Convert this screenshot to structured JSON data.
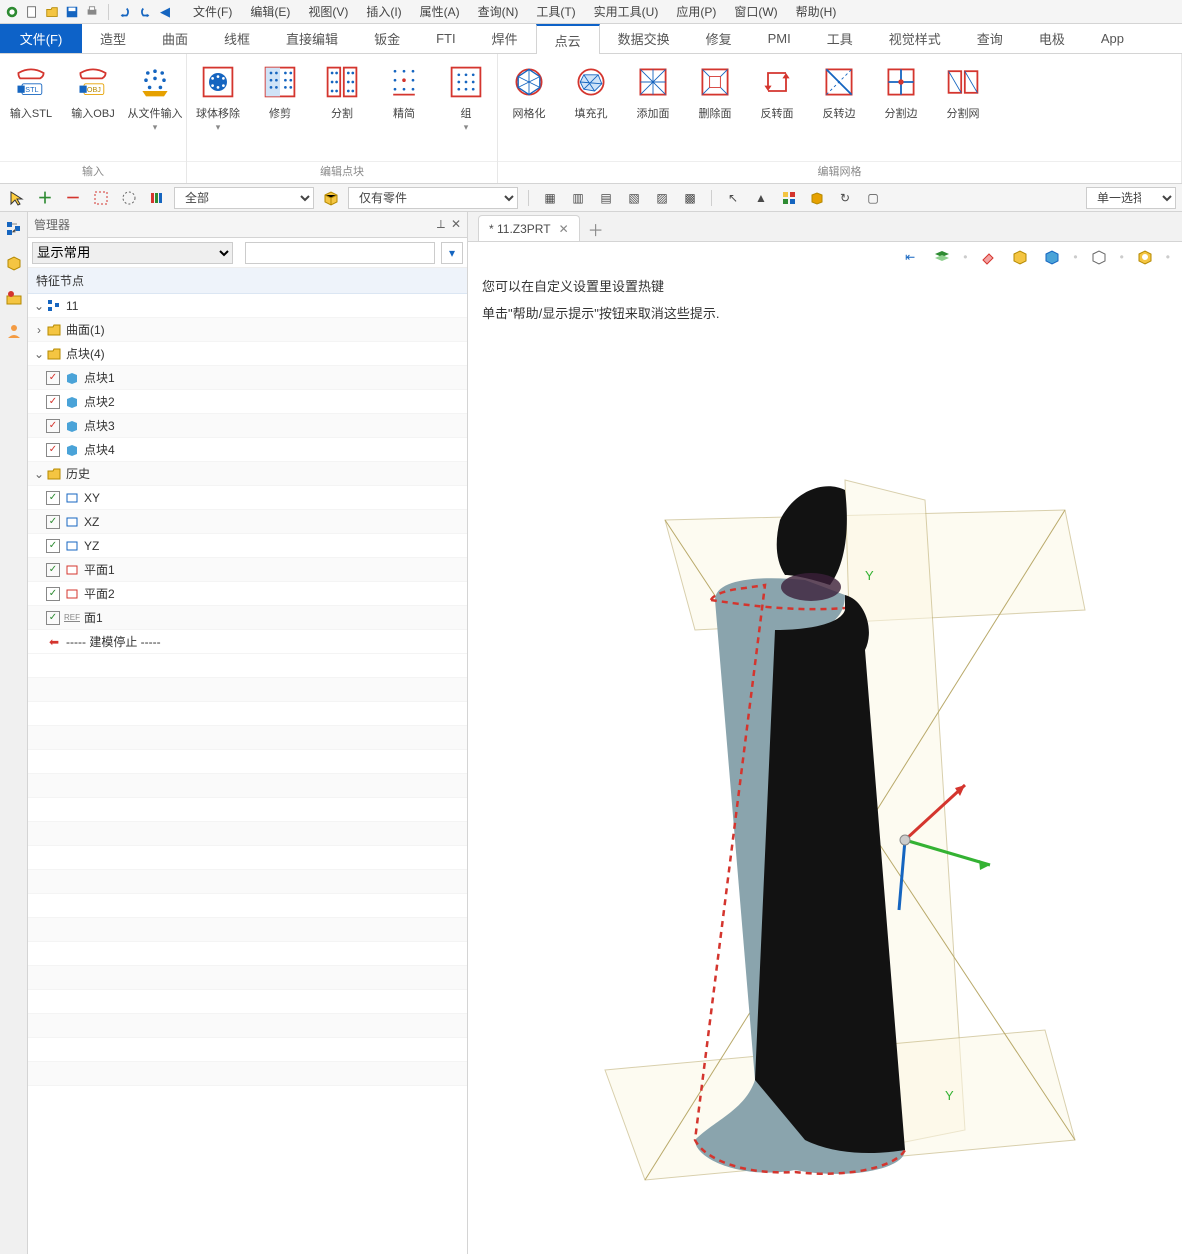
{
  "menus": {
    "items": [
      "文件(F)",
      "编辑(E)",
      "视图(V)",
      "插入(I)",
      "属性(A)",
      "查询(N)",
      "工具(T)",
      "实用工具(U)",
      "应用(P)",
      "窗口(W)",
      "帮助(H)"
    ]
  },
  "file_tab": "文件(F)",
  "ribbon_tabs": [
    "造型",
    "曲面",
    "线框",
    "直接编辑",
    "钣金",
    "FTI",
    "焊件",
    "点云",
    "数据交换",
    "修复",
    "PMI",
    "工具",
    "视觉样式",
    "查询",
    "电极",
    "App"
  ],
  "ribbon_active": "点云",
  "ribbon_groups": [
    {
      "label": "输入",
      "buttons": [
        {
          "name": "import-stl",
          "label": "输入STL",
          "icon": "stl"
        },
        {
          "name": "import-obj",
          "label": "输入OBJ",
          "icon": "obj"
        },
        {
          "name": "import-file",
          "label": "从文件输入",
          "icon": "dots",
          "drop": true
        }
      ]
    },
    {
      "label": "编辑点块",
      "buttons": [
        {
          "name": "sphere-remove",
          "label": "球体移除",
          "icon": "sph",
          "drop": true
        },
        {
          "name": "trim",
          "label": "修剪",
          "icon": "cell"
        },
        {
          "name": "split",
          "label": "分割",
          "icon": "cell2"
        },
        {
          "name": "simplify",
          "label": "精简",
          "icon": "cell3"
        },
        {
          "name": "group",
          "label": "组",
          "icon": "cell4",
          "drop": true
        }
      ]
    },
    {
      "label": "编辑网格",
      "buttons": [
        {
          "name": "meshify",
          "label": "网格化",
          "icon": "mesh"
        },
        {
          "name": "fill-hole",
          "label": "填充孔",
          "icon": "mesh"
        },
        {
          "name": "add-face",
          "label": "添加面",
          "icon": "mesh"
        },
        {
          "name": "delete-face",
          "label": "删除面",
          "icon": "mesh"
        },
        {
          "name": "flip-face",
          "label": "反转面",
          "icon": "flip"
        },
        {
          "name": "flip-edge",
          "label": "反转边",
          "icon": "mesh"
        },
        {
          "name": "split-edge",
          "label": "分割边",
          "icon": "mesh"
        },
        {
          "name": "split-mesh",
          "label": "分割网",
          "icon": "mesh"
        }
      ]
    }
  ],
  "aux": {
    "filter1": "全部",
    "filter2": "仅有零件",
    "right_mode": "单一选择"
  },
  "manager": {
    "title": "管理器",
    "view_combo": "显示常用",
    "section": "特征节点"
  },
  "tree": {
    "root": "11",
    "surface": "曲面(1)",
    "blocks_folder": "点块(4)",
    "blocks": [
      "点块1",
      "点块2",
      "点块3",
      "点块4"
    ],
    "history": "历史",
    "planes": [
      "XY",
      "XZ",
      "YZ",
      "平面1",
      "平面2"
    ],
    "ref": "面1",
    "stop": "----- 建模停止 -----"
  },
  "doc_tab": "* 11.Z3PRT",
  "hints": [
    "您可以在自定义设置里设置热键",
    "单击\"帮助/显示提示\"按钮来取消这些提示."
  ]
}
